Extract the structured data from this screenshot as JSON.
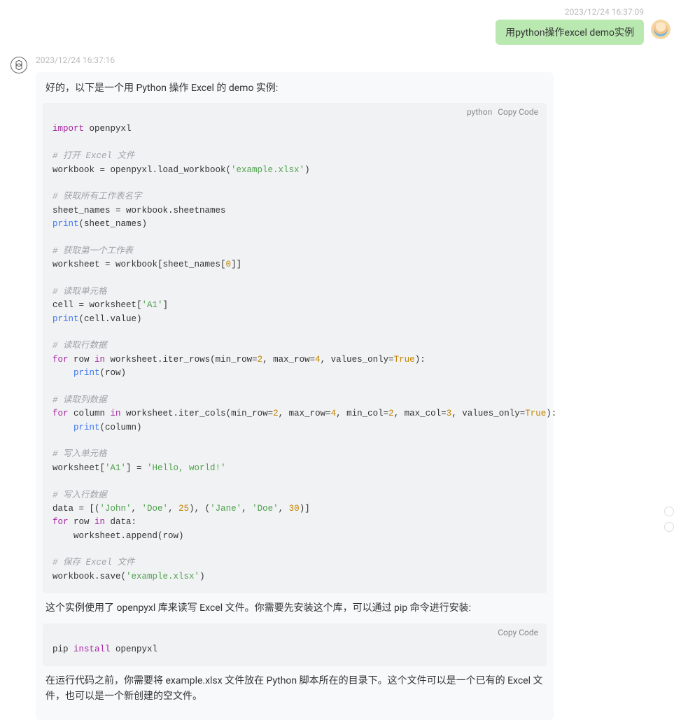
{
  "user": {
    "timestamp": "2023/12/24 16:37:09",
    "message": "用python操作excel demo实例"
  },
  "assistant": {
    "timestamp": "2023/12/24 16:37:16",
    "intro": "好的，以下是一个用 Python 操作 Excel 的 demo 实例:",
    "code1": {
      "lang": "python",
      "copy_label": "Copy Code",
      "lines": {
        "l1_kw": "import",
        "l1_mod": " openpyxl",
        "c1": "# 打开 Excel 文件",
        "l2a": "workbook = openpyxl.load_workbook(",
        "l2s": "'example.xlsx'",
        "l2b": ")",
        "c2": "# 获取所有工作表名字",
        "l3": "sheet_names = workbook.sheetnames",
        "l4_fn": "print",
        "l4_rest": "(sheet_names)",
        "c3": "# 获取第一个工作表",
        "l5a": "worksheet = workbook[sheet_names[",
        "l5n": "0",
        "l5b": "]]",
        "c4": "# 读取单元格",
        "l6a": "cell = worksheet[",
        "l6s": "'A1'",
        "l6b": "]",
        "l7_fn": "print",
        "l7_rest": "(cell.value)",
        "c5": "# 读取行数据",
        "l8_for": "for",
        "l8_a": " row ",
        "l8_in": "in",
        "l8_b": " worksheet.iter_rows(min_row=",
        "l8_n1": "2",
        "l8_c": ", max_row=",
        "l8_n2": "4",
        "l8_d": ", values_only=",
        "l8_bool": "True",
        "l8_e": "):",
        "l9_fn": "print",
        "l9_rest": "(row)",
        "c6": "# 读取列数据",
        "l10_for": "for",
        "l10_a": " column ",
        "l10_in": "in",
        "l10_b": " worksheet.iter_cols(min_row=",
        "l10_n1": "2",
        "l10_c": ", max_row=",
        "l10_n2": "4",
        "l10_d": ", min_col=",
        "l10_n3": "2",
        "l10_e": ", max_col=",
        "l10_n4": "3",
        "l10_f": ", values_only=",
        "l10_bool": "True",
        "l10_g": "):",
        "l11_fn": "print",
        "l11_rest": "(column)",
        "c7": "# 写入单元格",
        "l12a": "worksheet[",
        "l12s1": "'A1'",
        "l12b": "] = ",
        "l12s2": "'Hello, world!'",
        "c8": "# 写入行数据",
        "l13a": "data = [(",
        "l13s1": "'John'",
        "l13b": ", ",
        "l13s2": "'Doe'",
        "l13c": ", ",
        "l13n1": "25",
        "l13d": "), (",
        "l13s3": "'Jane'",
        "l13e": ", ",
        "l13s4": "'Doe'",
        "l13f": ", ",
        "l13n2": "30",
        "l13g": ")]",
        "l14_for": "for",
        "l14_a": " row ",
        "l14_in": "in",
        "l14_b": " data:",
        "l15": "    worksheet.append(row)",
        "c9": "# 保存 Excel 文件",
        "l16a": "workbook.save(",
        "l16s": "'example.xlsx'",
        "l16b": ")"
      }
    },
    "middle_text": "这个实例使用了 openpyxl 库来读写 Excel 文件。你需要先安装这个库，可以通过 pip 命令进行安装:",
    "code2": {
      "copy_label": "Copy Code",
      "l1a": "pip ",
      "l1_kw": "install",
      "l1b": " openpyxl"
    },
    "end_text": "在运行代码之前，你需要将 example.xlsx 文件放在 Python 脚本所在的目录下。这个文件可以是一个已有的 Excel 文件，也可以是一个新创建的空文件。"
  }
}
